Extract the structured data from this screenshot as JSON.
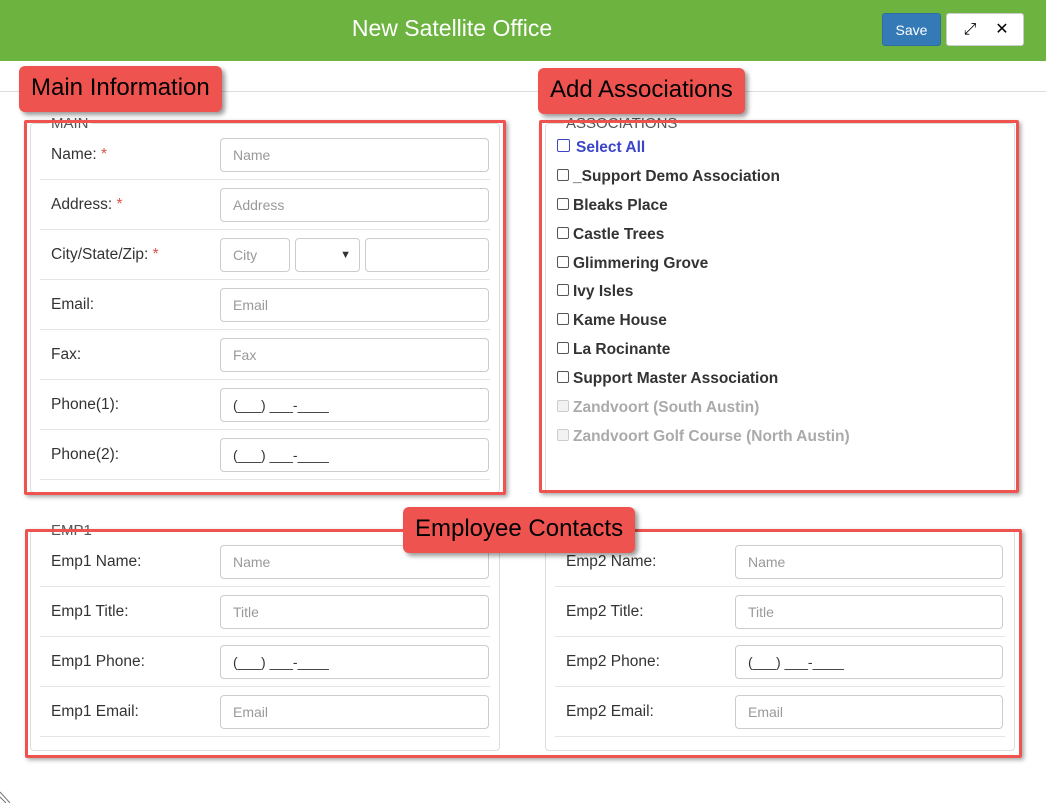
{
  "header": {
    "title": "New Satellite Office",
    "save_label": "Save",
    "expand_icon": "⤢",
    "close_icon": "✕"
  },
  "main": {
    "legend": "MAIN",
    "fields": {
      "name": {
        "label": "Name:",
        "required": "*",
        "placeholder": "Name"
      },
      "address": {
        "label": "Address:",
        "required": "*",
        "placeholder": "Address"
      },
      "city_state_zip": {
        "label": "City/State/Zip:",
        "required": "*",
        "city_placeholder": "City",
        "state_value": "",
        "zip_value": ""
      },
      "email": {
        "label": "Email:",
        "placeholder": "Email"
      },
      "fax": {
        "label": "Fax:",
        "placeholder": "Fax"
      },
      "phone1": {
        "label": "Phone(1):",
        "mask": "(___) ___-____"
      },
      "phone2": {
        "label": "Phone(2):",
        "mask": "(___) ___-____"
      }
    }
  },
  "associations": {
    "legend": "ASSOCIATIONS",
    "select_all": "Select All",
    "items": [
      {
        "label": "_Support Demo Association",
        "disabled": false
      },
      {
        "label": "Bleaks Place",
        "disabled": false
      },
      {
        "label": "Castle Trees",
        "disabled": false
      },
      {
        "label": "Glimmering Grove",
        "disabled": false
      },
      {
        "label": "Ivy Isles",
        "disabled": false
      },
      {
        "label": "Kame House",
        "disabled": false
      },
      {
        "label": "La Rocinante",
        "disabled": false
      },
      {
        "label": "Support Master Association",
        "disabled": false
      },
      {
        "label": "Zandvoort (South Austin)",
        "disabled": true
      },
      {
        "label": "Zandvoort Golf Course (North Austin)",
        "disabled": true
      }
    ]
  },
  "emp1": {
    "legend": "EMP1",
    "name": {
      "label": "Emp1 Name:",
      "placeholder": "Name"
    },
    "title": {
      "label": "Emp1 Title:",
      "placeholder": "Title"
    },
    "phone": {
      "label": "Emp1 Phone:",
      "mask": "(___) ___-____"
    },
    "email": {
      "label": "Emp1 Email:",
      "placeholder": "Email"
    }
  },
  "emp2": {
    "name": {
      "label": "Emp2 Name:",
      "placeholder": "Name"
    },
    "title": {
      "label": "Emp2 Title:",
      "placeholder": "Title"
    },
    "phone": {
      "label": "Emp2 Phone:",
      "mask": "(___) ___-____"
    },
    "email": {
      "label": "Emp2 Email:",
      "placeholder": "Email"
    }
  },
  "callouts": {
    "main_information": "Main Information",
    "add_associations": "Add Associations",
    "employee_contacts": "Employee Contacts"
  },
  "colors": {
    "header_bg": "#6db33f",
    "save_button": "#337ab7",
    "highlight": "#ef5350",
    "select_all_text": "#3a45c8",
    "required": "#d9534f"
  }
}
